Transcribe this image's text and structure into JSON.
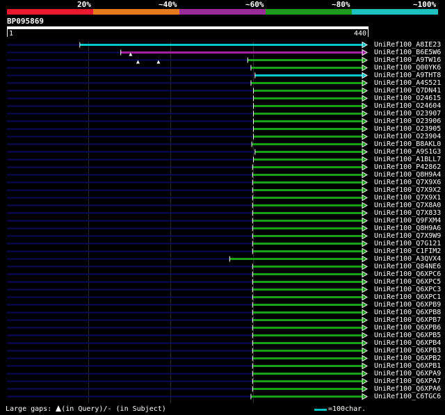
{
  "header": {
    "percent_labels": [
      "20%",
      "~40%",
      "~60%",
      "~80%",
      "~100%"
    ],
    "band_colors": [
      "#e8192c",
      "#e87a1e",
      "#9a2c9a",
      "#1e9a1e",
      "#1ec0c0"
    ],
    "query_id": "BP095869",
    "ruler_start": "1",
    "ruler_end": "440"
  },
  "footer": {
    "gaps_prefix": "Large gaps: ",
    "gaps_query": "(in Query)/",
    "gaps_subject": "- (in Subject)",
    "scale_label": "=100char."
  },
  "chart_data": {
    "type": "alignment",
    "query_length": 440,
    "x_range": [
      1,
      440
    ],
    "colors": {
      "background_line": "#0a0a5a",
      "cyan": "#00c8c8",
      "magenta": "#a020a0",
      "green": "#18a018"
    },
    "hits": [
      {
        "label": "UniRef100_A8IE23",
        "start": 90,
        "end": 440,
        "color": "cyan"
      },
      {
        "label": "UniRef100_B6E5W6",
        "start": 140,
        "end": 440,
        "color": "magenta"
      },
      {
        "label": "UniRef100_A9TW16",
        "start": 295,
        "end": 440,
        "color": "green"
      },
      {
        "label": "UniRef100_Q00YK6",
        "start": 299,
        "end": 440,
        "color": "green"
      },
      {
        "label": "UniRef100_A9THT8",
        "start": 304,
        "end": 440,
        "color": "cyan"
      },
      {
        "label": "UniRef100_A4S521",
        "start": 299,
        "end": 440,
        "color": "green"
      },
      {
        "label": "UniRef100_Q7DN41",
        "start": 302,
        "end": 440,
        "color": "green"
      },
      {
        "label": "UniRef100_O24615",
        "start": 302,
        "end": 440,
        "color": "green"
      },
      {
        "label": "UniRef100_O24604",
        "start": 302,
        "end": 440,
        "color": "green"
      },
      {
        "label": "UniRef100_O23907",
        "start": 302,
        "end": 440,
        "color": "green"
      },
      {
        "label": "UniRef100_O23906",
        "start": 302,
        "end": 440,
        "color": "green"
      },
      {
        "label": "UniRef100_O23905",
        "start": 302,
        "end": 440,
        "color": "green"
      },
      {
        "label": "UniRef100_O23904",
        "start": 302,
        "end": 440,
        "color": "green"
      },
      {
        "label": "UniRef100_B8AKL0",
        "start": 300,
        "end": 440,
        "color": "green"
      },
      {
        "label": "UniRef100_A9S1G3",
        "start": 304,
        "end": 440,
        "color": "green"
      },
      {
        "label": "UniRef100_A1BLL7",
        "start": 302,
        "end": 440,
        "color": "green"
      },
      {
        "label": "UniRef100_P42862",
        "start": 301,
        "end": 440,
        "color": "green"
      },
      {
        "label": "UniRef100_Q8H9A4",
        "start": 301,
        "end": 440,
        "color": "green"
      },
      {
        "label": "UniRef100_Q7X9X6",
        "start": 301,
        "end": 440,
        "color": "green"
      },
      {
        "label": "UniRef100_Q7X9X2",
        "start": 301,
        "end": 440,
        "color": "green"
      },
      {
        "label": "UniRef100_Q7X9X1",
        "start": 301,
        "end": 440,
        "color": "green"
      },
      {
        "label": "UniRef100_Q7X8A0",
        "start": 301,
        "end": 440,
        "color": "green"
      },
      {
        "label": "UniRef100_Q7X833",
        "start": 301,
        "end": 440,
        "color": "green"
      },
      {
        "label": "UniRef100_Q9FXM4",
        "start": 301,
        "end": 440,
        "color": "green"
      },
      {
        "label": "UniRef100_Q8H9A6",
        "start": 301,
        "end": 440,
        "color": "green"
      },
      {
        "label": "UniRef100_Q7X9W9",
        "start": 301,
        "end": 440,
        "color": "green"
      },
      {
        "label": "UniRef100_Q7G121",
        "start": 301,
        "end": 440,
        "color": "green"
      },
      {
        "label": "UniRef100_C1FIM2",
        "start": 301,
        "end": 440,
        "color": "green"
      },
      {
        "label": "UniRef100_A3QVX4",
        "start": 273,
        "end": 440,
        "color": "green"
      },
      {
        "label": "UniRef100_Q84NE6",
        "start": 301,
        "end": 440,
        "color": "green"
      },
      {
        "label": "UniRef100_Q6XPC6",
        "start": 301,
        "end": 440,
        "color": "green"
      },
      {
        "label": "UniRef100_Q6XPC5",
        "start": 301,
        "end": 440,
        "color": "green"
      },
      {
        "label": "UniRef100_Q6XPC3",
        "start": 301,
        "end": 440,
        "color": "green"
      },
      {
        "label": "UniRef100_Q6XPC1",
        "start": 301,
        "end": 440,
        "color": "green"
      },
      {
        "label": "UniRef100_Q6XPB9",
        "start": 301,
        "end": 440,
        "color": "green"
      },
      {
        "label": "UniRef100_Q6XPB8",
        "start": 301,
        "end": 440,
        "color": "green"
      },
      {
        "label": "UniRef100_Q6XPB7",
        "start": 301,
        "end": 440,
        "color": "green"
      },
      {
        "label": "UniRef100_Q6XPB6",
        "start": 301,
        "end": 440,
        "color": "green"
      },
      {
        "label": "UniRef100_Q6XPB5",
        "start": 301,
        "end": 440,
        "color": "green"
      },
      {
        "label": "UniRef100_Q6XPB4",
        "start": 301,
        "end": 440,
        "color": "green"
      },
      {
        "label": "UniRef100_Q6XPB3",
        "start": 301,
        "end": 440,
        "color": "green"
      },
      {
        "label": "UniRef100_Q6XPB2",
        "start": 301,
        "end": 440,
        "color": "green"
      },
      {
        "label": "UniRef100_Q6XPB1",
        "start": 301,
        "end": 440,
        "color": "green"
      },
      {
        "label": "UniRef100_Q6XPA9",
        "start": 301,
        "end": 440,
        "color": "green"
      },
      {
        "label": "UniRef100_Q6XPA7",
        "start": 301,
        "end": 440,
        "color": "green"
      },
      {
        "label": "UniRef100_Q6XPA6",
        "start": 301,
        "end": 440,
        "color": "green"
      },
      {
        "label": "UniRef100_C6TGC6",
        "start": 299,
        "end": 440,
        "color": "green"
      }
    ],
    "gaps": [
      {
        "hit": 1,
        "position": 152,
        "type": "query"
      },
      {
        "hit": 2,
        "position": 161,
        "type": "query"
      },
      {
        "hit": 2,
        "position": 186,
        "type": "query"
      }
    ]
  }
}
